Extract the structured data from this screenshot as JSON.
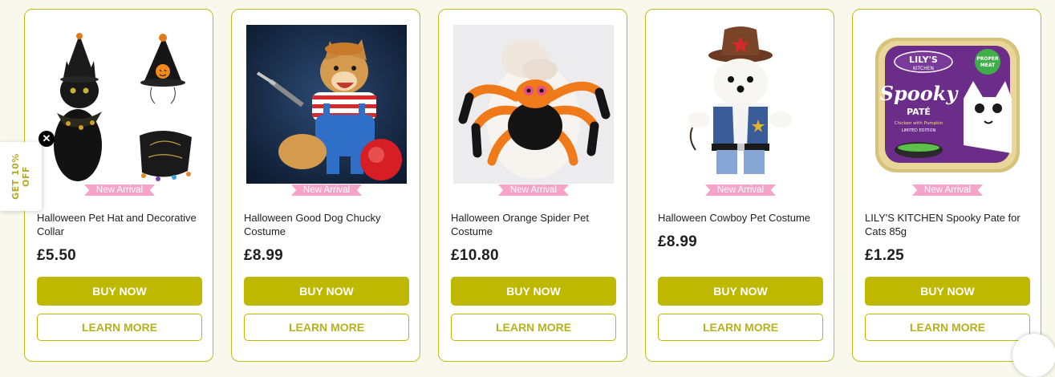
{
  "promo": {
    "line1": "GET 10%",
    "line2": "OFF",
    "close_icon": "close-icon"
  },
  "products": [
    {
      "title": "Halloween Pet Hat and Decorative Collar",
      "price": "£5.50",
      "badge": "New Arrival",
      "buy_label": "BUY NOW",
      "learn_label": "LEARN MORE"
    },
    {
      "title": "Halloween Good Dog Chucky Costume",
      "price": "£8.99",
      "badge": "New Arrival",
      "buy_label": "BUY NOW",
      "learn_label": "LEARN MORE"
    },
    {
      "title": "Halloween Orange Spider Pet Costume",
      "price": "£10.80",
      "badge": "New Arrival",
      "buy_label": "BUY NOW",
      "learn_label": "LEARN MORE"
    },
    {
      "title": "Halloween Cowboy Pet Costume",
      "price": "£8.99",
      "badge": "New Arrival",
      "buy_label": "BUY NOW",
      "learn_label": "LEARN MORE"
    },
    {
      "title": "LILY'S KITCHEN Spooky Pate for Cats 85g",
      "price": "£1.25",
      "badge": "New Arrival",
      "buy_label": "BUY NOW",
      "learn_label": "LEARN MORE"
    }
  ],
  "image_labels": {
    "lily_brand": "LILY'S",
    "lily_sub": "KITCHEN",
    "lily_spooky": "Spooky",
    "lily_pate": "PATÉ",
    "lily_proper": "PROPER",
    "lily_meat": "MEAT",
    "lily_flavour": "Chicken with Pumpkin",
    "lily_edition": "LIMITED EDITION"
  },
  "colors": {
    "accent": "#bfb800",
    "badge": "#f5a3c8",
    "background": "#f8f9ec"
  }
}
